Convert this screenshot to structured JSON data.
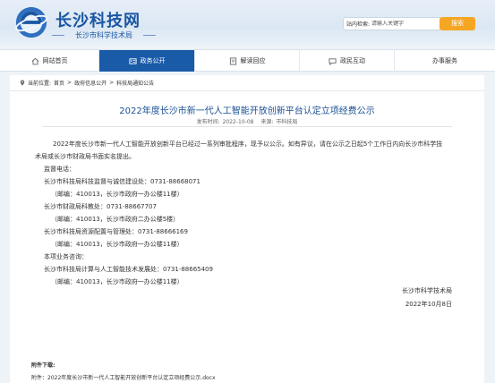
{
  "header": {
    "site_title": "长沙科技网",
    "site_subtitle": "长沙市科学技术局",
    "search_label": "站内检索:",
    "search_placeholder": "请输入关键字",
    "search_button": "搜索"
  },
  "nav": {
    "items": [
      {
        "label": "网站首页",
        "icon": "home-icon",
        "active": false
      },
      {
        "label": "政务公开",
        "icon": "id-card-icon",
        "active": true
      },
      {
        "label": "解读回应",
        "icon": "document-icon",
        "active": false
      },
      {
        "label": "政民互动",
        "icon": "chat-icon",
        "active": false
      },
      {
        "label": "办事服务",
        "icon": "",
        "active": false
      }
    ]
  },
  "breadcrumb": {
    "prefix": "当前位置:",
    "items": [
      "首页",
      "政府信息公开",
      "科技局通知公告"
    ],
    "separator": ">"
  },
  "article": {
    "title": "2022年度长沙市新一代人工智能开放创新平台认定立项经费公示",
    "publish_label": "发布时间:",
    "publish_date": "2022-10-08",
    "source_label": "来源:",
    "source": "市科技局",
    "lines": [
      "2022年度长沙市新一代人工智能开放创新平台已经过一系列审批程序，现予以公示。如有异议，请在公示之日起5个工作日内向长沙市科学技",
      "术局或长沙市财政局书面实名提出。",
      "监督电话：",
      "长沙市科技局科技监督与诚信建设处：0731-88668071",
      "（邮编：410013，长沙市政府一办公楼11楼）",
      "长沙市财政局科教处：0731-88667707",
      "（邮编：410013，长沙市政府二办公楼5楼）",
      "长沙市科技局资源配置与管理处：0731-88666169",
      "（邮编：410013，长沙市政府一办公楼11楼）",
      "本项业务咨询：",
      "长沙市科技局计算与人工智能技术发展处：0731-88665409",
      "（邮编：410013，长沙市政府一办公楼11楼）"
    ],
    "signer": "长沙市科学技术局",
    "sign_date": "2022年10月8日"
  },
  "attachments": {
    "title": "附件下载:",
    "prefix": "附件：",
    "file": "2022年度长沙市新一代人工智能开放创新平台认定立项经费公示.docx"
  },
  "colors": {
    "brand": "#1a56a3",
    "nav_active": "#1a5ba8",
    "search_button": "#f5a623",
    "background": "#eef3f8"
  }
}
